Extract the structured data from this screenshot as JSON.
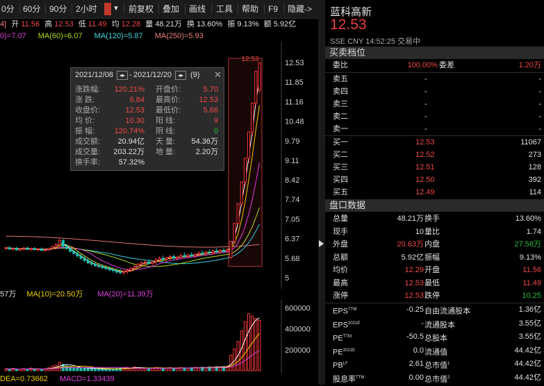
{
  "toolbar": {
    "items": [
      "0分",
      "60分",
      "90分",
      "2小时",
      "前复权",
      "叠加",
      "画线",
      "工具",
      "帮助",
      "F9",
      "隐藏->"
    ]
  },
  "info_line": {
    "prefix": "4]",
    "open_label": "开",
    "open": "11.56",
    "high_label": "高",
    "high": "12.53",
    "low_label": "低",
    "low": "11.49",
    "avg_label": "均",
    "avg": "12.28",
    "vol_label": "量",
    "vol": "48.21万",
    "turn_label": "换",
    "turn": "13.60%",
    "amp_label": "振",
    "amp": "9.13%",
    "amt_label": "额",
    "amt": "5.92亿"
  },
  "ma_line": {
    "ma_a": "0)=7.07",
    "ma60": "MA(60)=6.07",
    "ma120": "MA(120)=5.87",
    "ma250": "MA(250)=5.93"
  },
  "vol_line": {
    "v_a": "57万",
    "ma10": "MA(10)=20.50万",
    "ma20": "MA(20)=11.39万"
  },
  "macd_line": {
    "dea": "DEA=0.73662",
    "macd": "MACD=1.33439"
  },
  "tooltip": {
    "start_date": "2021/12/08",
    "end_date": "2021/12/20",
    "count": "(9)",
    "rows": [
      {
        "l1": "涨跌幅:",
        "v1": "120.21%",
        "c1": "red",
        "l2": "开盘价:",
        "v2": "5.70",
        "c2": "red"
      },
      {
        "l1": "涨    跌:",
        "v1": "6.84",
        "c1": "red",
        "l2": "最高价:",
        "v2": "12.53",
        "c2": "red"
      },
      {
        "l1": "收盘价:",
        "v1": "12.53",
        "c1": "red",
        "l2": "最低价:",
        "v2": "5.66",
        "c2": "red"
      },
      {
        "l1": "均    价:",
        "v1": "10.30",
        "c1": "red",
        "l2": "阳    线:",
        "v2": "9",
        "c2": "red"
      },
      {
        "l1": "振    幅:",
        "v1": "120.74%",
        "c1": "red",
        "l2": "阴    线:",
        "v2": "0",
        "c2": "green"
      },
      {
        "l1": "成交额:",
        "v1": "20.94亿",
        "c1": "white",
        "l2": "天    量:",
        "v2": "54.36万",
        "c2": "white"
      },
      {
        "l1": "成交量:",
        "v1": "203.22万",
        "c1": "white",
        "l2": "地    量:",
        "v2": "2.20万",
        "c2": "white"
      },
      {
        "l1": "换手率:",
        "v1": "57.32%",
        "c1": "white",
        "l2": "",
        "v2": "",
        "c2": "white"
      }
    ]
  },
  "chart_data": [
    {
      "type": "candlestick",
      "y_ticks": [
        "12.53",
        "11.85",
        "11.16",
        "10.48",
        "9.79",
        "9.11",
        "8.42",
        "7.74",
        "7.05",
        "6.37",
        "5.68",
        "5"
      ],
      "ylim": [
        5,
        12.53
      ],
      "top_label": "12.53",
      "series": [
        {
          "name": "MA(60)"
        },
        {
          "name": "MA(120)"
        },
        {
          "name": "MA(250)"
        }
      ],
      "ohlc": [
        [
          6.02,
          6.08,
          5.96,
          6.05
        ],
        [
          6.05,
          6.1,
          5.98,
          6.0
        ],
        [
          6.0,
          6.06,
          5.94,
          6.03
        ],
        [
          6.03,
          6.09,
          5.99,
          5.97
        ],
        [
          5.97,
          6.04,
          5.92,
          6.01
        ],
        [
          6.01,
          6.07,
          5.95,
          6.04
        ],
        [
          6.04,
          6.08,
          5.97,
          5.99
        ],
        [
          5.99,
          6.05,
          5.93,
          6.02
        ],
        [
          6.02,
          6.07,
          5.96,
          5.98
        ],
        [
          5.98,
          6.03,
          5.92,
          6.0
        ],
        [
          6.0,
          6.06,
          5.94,
          5.95
        ],
        [
          5.95,
          6.01,
          5.9,
          5.98
        ],
        [
          5.98,
          6.05,
          5.93,
          6.02
        ],
        [
          6.02,
          6.12,
          5.98,
          6.08
        ],
        [
          6.08,
          6.22,
          6.02,
          6.15
        ],
        [
          6.15,
          6.4,
          6.08,
          6.3
        ],
        [
          6.3,
          6.36,
          6.05,
          6.1
        ],
        [
          6.1,
          6.18,
          5.98,
          6.02
        ],
        [
          6.02,
          6.08,
          5.88,
          5.92
        ],
        [
          5.92,
          5.98,
          5.8,
          5.85
        ],
        [
          5.85,
          5.92,
          5.72,
          5.76
        ],
        [
          5.76,
          5.84,
          5.62,
          5.68
        ],
        [
          5.68,
          5.76,
          5.55,
          5.6
        ],
        [
          5.6,
          5.7,
          5.48,
          5.52
        ],
        [
          5.52,
          5.62,
          5.42,
          5.47
        ],
        [
          5.47,
          5.56,
          5.38,
          5.42
        ],
        [
          5.42,
          5.52,
          5.34,
          5.39
        ],
        [
          5.39,
          5.48,
          5.3,
          5.35
        ],
        [
          5.35,
          5.44,
          5.26,
          5.32
        ],
        [
          5.32,
          5.4,
          5.22,
          5.28
        ],
        [
          5.28,
          5.36,
          5.18,
          5.25
        ],
        [
          5.25,
          5.32,
          5.14,
          5.2
        ],
        [
          5.2,
          5.3,
          5.12,
          5.18
        ],
        [
          5.18,
          5.28,
          5.1,
          5.22
        ],
        [
          5.22,
          5.32,
          5.14,
          5.26
        ],
        [
          5.26,
          5.38,
          5.2,
          5.33
        ],
        [
          5.33,
          5.44,
          5.26,
          5.4
        ],
        [
          5.4,
          5.52,
          5.34,
          5.47
        ],
        [
          5.47,
          5.58,
          5.4,
          5.52
        ],
        [
          5.52,
          5.62,
          5.44,
          5.55
        ],
        [
          5.55,
          5.64,
          5.46,
          5.5
        ],
        [
          5.5,
          5.6,
          5.42,
          5.56
        ],
        [
          5.56,
          5.68,
          5.48,
          5.62
        ],
        [
          5.62,
          5.74,
          5.54,
          5.68
        ],
        [
          5.68,
          5.78,
          5.58,
          5.64
        ],
        [
          5.64,
          5.74,
          5.56,
          5.7
        ],
        [
          5.7,
          5.8,
          5.62,
          5.74
        ],
        [
          5.74,
          5.82,
          5.64,
          5.68
        ],
        [
          5.68,
          5.78,
          5.6,
          5.72
        ],
        [
          5.72,
          5.84,
          5.66,
          5.78
        ],
        [
          5.78,
          5.88,
          5.7,
          5.74
        ],
        [
          5.74,
          5.84,
          5.66,
          5.8
        ],
        [
          5.8,
          5.9,
          5.72,
          5.76
        ],
        [
          5.76,
          5.86,
          5.68,
          5.82
        ],
        [
          5.82,
          5.92,
          5.74,
          5.86
        ],
        [
          5.86,
          5.96,
          5.78,
          5.84
        ],
        [
          5.84,
          5.94,
          5.76,
          5.9
        ],
        [
          5.9,
          6.0,
          5.82,
          5.88
        ],
        [
          5.88,
          5.98,
          5.8,
          5.94
        ],
        [
          5.94,
          6.04,
          5.86,
          5.9
        ],
        [
          5.9,
          6.0,
          5.84,
          5.96
        ],
        [
          5.96,
          6.04,
          5.88,
          5.92
        ],
        [
          5.92,
          6.02,
          5.86,
          5.98
        ],
        [
          5.7,
          6.27,
          5.66,
          6.27
        ],
        [
          6.27,
          6.9,
          6.2,
          6.9
        ],
        [
          6.9,
          7.59,
          6.85,
          7.59
        ],
        [
          7.59,
          8.35,
          7.5,
          8.35
        ],
        [
          8.35,
          9.18,
          8.2,
          9.18
        ],
        [
          9.18,
          10.1,
          9.0,
          10.1
        ],
        [
          10.1,
          11.11,
          9.95,
          11.11
        ],
        [
          11.11,
          12.22,
          11.0,
          12.22
        ],
        [
          11.56,
          12.53,
          11.49,
          12.53
        ]
      ]
    },
    {
      "type": "bar",
      "y_ticks": [
        "600000",
        "400000",
        "200000"
      ],
      "ylim": [
        0,
        650000
      ],
      "values": [
        18000,
        15000,
        22000,
        12000,
        16000,
        20000,
        14000,
        25000,
        11000,
        17000,
        13000,
        19000,
        28000,
        46000,
        52000,
        82000,
        60000,
        44000,
        36000,
        30000,
        26000,
        24000,
        30000,
        20000,
        18000,
        16000,
        22000,
        14000,
        17000,
        19000,
        15000,
        21000,
        24000,
        28000,
        32000,
        26000,
        35000,
        30000,
        24000,
        22000,
        20000,
        26000,
        31000,
        28000,
        22000,
        25000,
        29000,
        23000,
        26000,
        30000,
        27000,
        24000,
        29000,
        32000,
        28000,
        34000,
        30000,
        36000,
        33000,
        38000,
        35000,
        40000,
        42000,
        150000,
        210000,
        280000,
        380000,
        470000,
        543600,
        520000,
        500000,
        482100
      ]
    }
  ],
  "right_panel": {
    "name": "蓝科高新",
    "price": "12.53",
    "meta": "SSE  CNY  14:52:25  交易中",
    "orderbook_title": "买卖档位",
    "weibi_label": "委比",
    "weibi": "100.00%",
    "weicha_label": "委差",
    "weicha": "1.20万",
    "sells": [
      {
        "label": "卖五",
        "price": "-",
        "vol": "-"
      },
      {
        "label": "卖四",
        "price": "-",
        "vol": "-"
      },
      {
        "label": "卖三",
        "price": "-",
        "vol": "-"
      },
      {
        "label": "卖二",
        "price": "-",
        "vol": "-"
      },
      {
        "label": "卖一",
        "price": "-",
        "vol": "-"
      }
    ],
    "buys": [
      {
        "label": "买一",
        "price": "12.53",
        "vol": "11067"
      },
      {
        "label": "买二",
        "price": "12.52",
        "vol": "273"
      },
      {
        "label": "买三",
        "price": "12.51",
        "vol": "128"
      },
      {
        "label": "买四",
        "price": "12.50",
        "vol": "392"
      },
      {
        "label": "买五",
        "price": "12.49",
        "vol": "114"
      }
    ],
    "quote_title": "盘口数据",
    "quotes": [
      {
        "l1": "总量",
        "v1": "48.21万",
        "c1": "white",
        "l2": "换手",
        "v2": "13.60%",
        "c2": "white"
      },
      {
        "l1": "现手",
        "v1": "10",
        "c1": "white",
        "l2": "量比",
        "v2": "1.74",
        "c2": "white"
      },
      {
        "l1": "外盘",
        "v1": "20.63万",
        "c1": "red",
        "l2": "内盘",
        "v2": "27.58万",
        "c2": "green"
      },
      {
        "l1": "总额",
        "v1": "5.92亿",
        "c1": "white",
        "l2": "振幅",
        "v2": "9.13%",
        "c2": "white"
      },
      {
        "l1": "均价",
        "v1": "12.29",
        "c1": "red",
        "l2": "开盘",
        "v2": "11.56",
        "c2": "red"
      },
      {
        "l1": "最高",
        "v1": "12.53",
        "c1": "red",
        "l2": "最低",
        "v2": "11.49",
        "c2": "red"
      },
      {
        "l1": "涨停",
        "v1": "12.53",
        "c1": "red",
        "l2": "跌停",
        "v2": "10.25",
        "c2": "green"
      }
    ],
    "fundamentals": [
      {
        "l1": "EPS",
        "s1": "TTM",
        "v1": "-0.25",
        "l2": "自由流通股本",
        "s2": "",
        "v2": "1.36亿"
      },
      {
        "l1": "EPS",
        "s1": "2021E",
        "v1": "-",
        "l2": "流通股本",
        "s2": "",
        "v2": "3.55亿"
      },
      {
        "l1": "PE",
        "s1": "TTM",
        "v1": "-50.5",
        "l2": "总股本",
        "s2": "",
        "v2": "3.55亿"
      },
      {
        "l1": "PE",
        "s1": "2021E",
        "v1": "0.0",
        "l2": "流通值",
        "s2": "",
        "v2": "44.42亿"
      },
      {
        "l1": "PB",
        "s1": "LF",
        "v1": "2.61",
        "l2": "总市值",
        "s2": "1",
        "v2": "44.42亿"
      },
      {
        "l1": "股息率",
        "s1": "TTM",
        "v1": "0.00",
        "l2": "总市值",
        "s2": "2",
        "v2": "44.42亿"
      }
    ]
  }
}
